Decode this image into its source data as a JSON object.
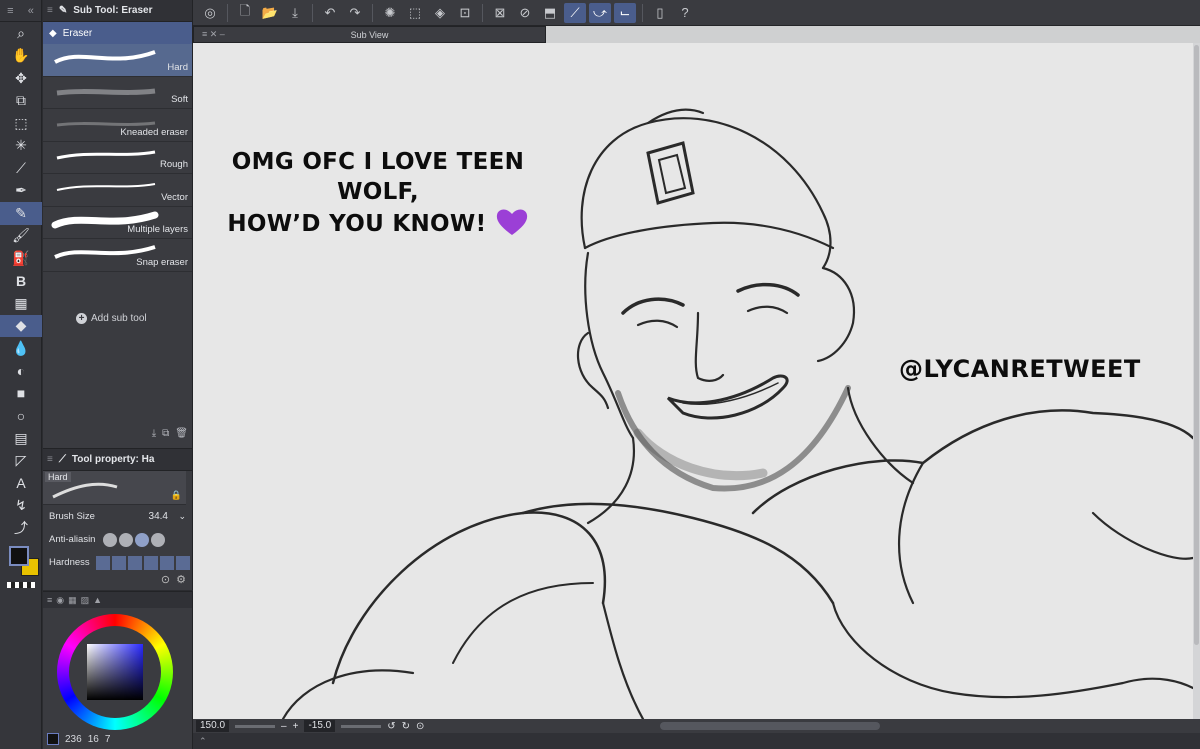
{
  "subtool_panel": {
    "title": "Sub Tool: Eraser",
    "group": "Eraser",
    "brushes": [
      {
        "label": "Hard",
        "selected": true
      },
      {
        "label": "Soft",
        "selected": false
      },
      {
        "label": "Kneaded eraser",
        "selected": false
      },
      {
        "label": "Rough",
        "selected": false
      },
      {
        "label": "Vector",
        "selected": false
      },
      {
        "label": "Multiple layers",
        "selected": false
      },
      {
        "label": "Snap eraser",
        "selected": false
      }
    ],
    "add_label": "Add sub tool"
  },
  "tool_property": {
    "title": "Tool property: Ha",
    "preset": "Hard",
    "brush_size_label": "Brush Size",
    "brush_size_value": "34.4",
    "antialias_label": "Anti-aliasin",
    "hardness_label": "Hardness"
  },
  "sub_view": {
    "title": "Sub View"
  },
  "canvas": {
    "caption_line1": "OMG OFC I LOVE TEEN WOLF,",
    "caption_line2": "HOW’D YOU KNOW!",
    "handle": "@LYCANRETWEET"
  },
  "status_bar": {
    "zoom": "150.0",
    "rotation": "-15.0"
  },
  "color_panel": {
    "value_a": "236",
    "value_b": "16",
    "value_c": "7"
  },
  "colors": {
    "accent": "#4a5d8c",
    "panel": "#3a3b40",
    "canvas": "#e7e7e7",
    "main_color": "#111111",
    "sub_color": "#e8c200",
    "heart": "#9b3fd6"
  },
  "icons": {
    "tools": [
      "magnifier-icon",
      "hand-icon",
      "move-icon",
      "layer-move-icon",
      "selection-icon",
      "auto-select-icon",
      "eyedropper-icon",
      "pen-icon",
      "pencil-icon",
      "brush-icon",
      "airbrush-icon",
      "decoration-icon",
      "blend-icon",
      "eraser-icon",
      "fill-icon",
      "gradient-icon",
      "figure-icon",
      "frame-icon",
      "ruler-icon",
      "text-icon",
      "balloon-icon",
      "correction-icon"
    ]
  }
}
